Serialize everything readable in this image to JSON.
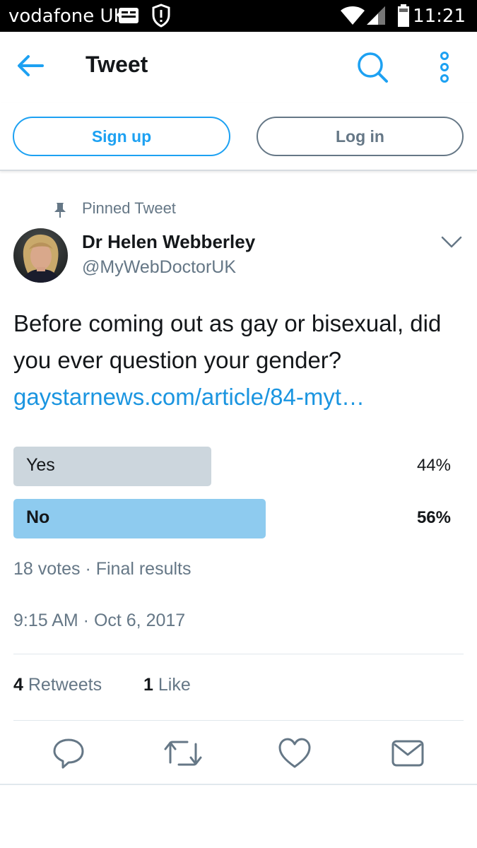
{
  "status_bar": {
    "carrier": "vodafone UK",
    "time": "11:21",
    "icons": [
      "sim-card-icon",
      "shield-alert-icon",
      "wifi-icon",
      "signal-icon",
      "battery-icon"
    ]
  },
  "header": {
    "title": "Tweet",
    "icons": [
      "back-arrow-icon",
      "search-icon",
      "more-vertical-icon"
    ]
  },
  "auth": {
    "signup_label": "Sign up",
    "login_label": "Log in"
  },
  "tweet": {
    "pinned_label": "Pinned Tweet",
    "author_name": "Dr Helen Webberley",
    "author_handle": "@MyWebDoctorUK",
    "text": "Before coming out as gay or bisexual, did you ever question your gender?",
    "link_text": "gaystarnews.com/article/84-myt…",
    "poll": {
      "options": [
        {
          "label": "Yes",
          "percent_text": "44%",
          "fraction": 0.44,
          "winner": false
        },
        {
          "label": "No",
          "percent_text": "56%",
          "fraction": 0.56,
          "winner": true
        }
      ],
      "meta": "18 votes · Final results"
    },
    "timestamp": "9:15 AM · Oct 6, 2017",
    "stats": {
      "retweets_count": "4",
      "retweets_label": "Retweets",
      "likes_count": "1",
      "likes_label": "Like"
    },
    "actions": [
      "reply-icon",
      "retweet-icon",
      "like-icon",
      "share-icon"
    ]
  },
  "colors": {
    "accent": "#1da1f2",
    "link": "#1b95e0",
    "muted": "#657786",
    "poll_winner": "#8ecbef",
    "poll_other": "#ccd6dd"
  }
}
